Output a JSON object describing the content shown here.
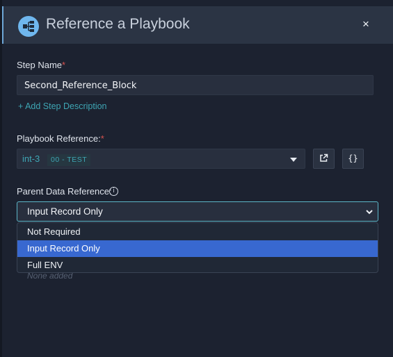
{
  "dialog": {
    "title": "Reference a Playbook",
    "close_label": "×"
  },
  "step_name": {
    "label": "Step Name",
    "required_mark": "*",
    "value": "Second_Reference_Block",
    "add_description_link": "+ Add Step Description"
  },
  "playbook_reference": {
    "label": "Playbook Reference:",
    "required_mark": "*",
    "code": "int-3",
    "tag": "00 - TEST",
    "open_button_icon": "external-link-icon",
    "json_button_label": "{}"
  },
  "parent_data_reference": {
    "label": "Parent Data Reference:",
    "info_icon": "i",
    "selected_value": "Input Record Only",
    "options": [
      {
        "label": "Not Required",
        "selected": false
      },
      {
        "label": "Input Record Only",
        "selected": true
      },
      {
        "label": "Full ENV",
        "selected": false
      }
    ]
  },
  "partially_hidden_placeholder": "None added",
  "colors": {
    "background": "#1c2230",
    "header": "#2b3444",
    "accent_teal": "#3ea6b4",
    "selection_blue": "#3868d0",
    "required_red": "#d9534f"
  }
}
